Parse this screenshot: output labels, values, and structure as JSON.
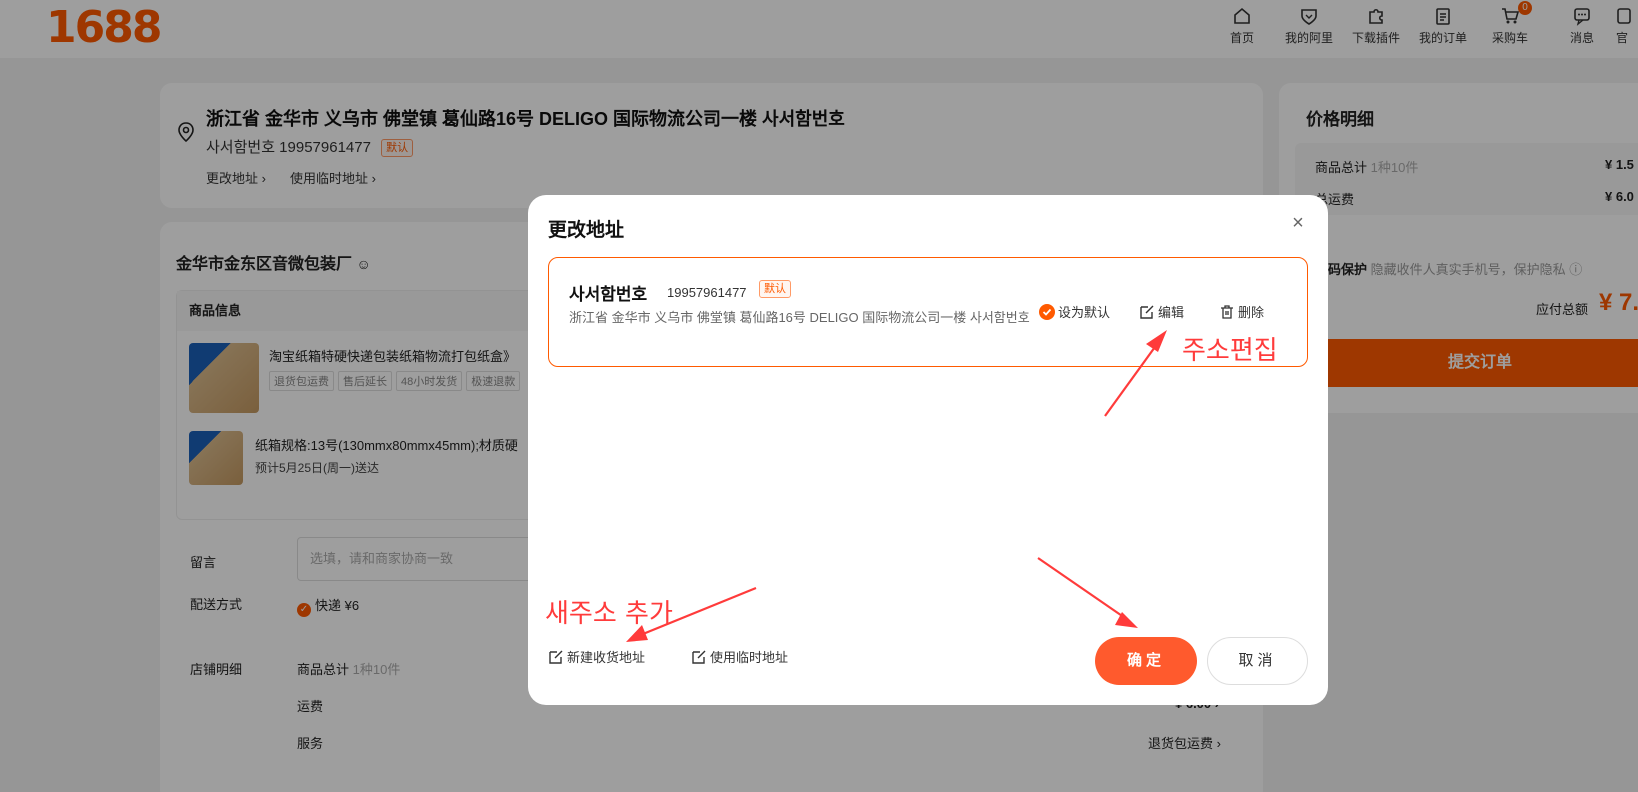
{
  "header": {
    "logo": "1688",
    "nav": [
      {
        "label": "首页",
        "icon": "home-icon"
      },
      {
        "label": "我的阿里",
        "icon": "heart-shield-icon"
      },
      {
        "label": "下载插件",
        "icon": "puzzle-icon"
      },
      {
        "label": "我的订单",
        "icon": "clipboard-icon"
      },
      {
        "label": "采购车",
        "icon": "cart-icon",
        "badge": "0"
      },
      {
        "label": "消息",
        "icon": "message-icon"
      },
      {
        "label": "官",
        "icon": "more-icon"
      }
    ]
  },
  "address_card": {
    "address_line": "浙江省 金华市 义乌市 佛堂镇 葛仙路16号 DELIGO 国际物流公司一楼 사서함번호",
    "name_phone": "사서함번호 19957961477",
    "default_tag": "默认",
    "change_link": "更改地址",
    "temp_link": "使用临时地址"
  },
  "shop": {
    "name": "金华市金东区音微包装厂",
    "goods_header": "商品信息",
    "item1": {
      "title": "淘宝纸箱特硬快递包装纸箱物流打包纸盒》",
      "tags": [
        "退货包运费",
        "售后延长",
        "48小时发货",
        "极速退款"
      ]
    },
    "item2": {
      "spec": "纸箱规格:13号(130mmx80mmx45mm);材质硬",
      "eta": "预计5月25日(周一)送达"
    },
    "message_label": "留言",
    "message_placeholder": "选填，请和商家协商一致",
    "shipping_label": "配送方式",
    "shipping_value": "快递 ¥6",
    "store_detail_label": "店铺明细",
    "goods_total_label": "商品总计",
    "goods_total_count": "1种10件",
    "freight_label": "运费",
    "freight_value": "¥ 6.00",
    "service_label": "服务",
    "service_value": "退货包运费"
  },
  "price_card": {
    "title": "价格明细",
    "goods_total_label": "商品总计",
    "goods_total_count": "1种10件",
    "goods_total_value": "¥ 1.5",
    "freight_label": "总运费",
    "freight_value": "¥ 6.0",
    "privacy_label": "号码保护",
    "privacy_desc": "隐藏收件人真实手机号，保护隐私",
    "payable_label": "应付总额",
    "payable_value": "¥ 7.",
    "submit": "提交订单"
  },
  "modal": {
    "title": "更改地址",
    "close": "×",
    "address": {
      "name": "사서함번호",
      "phone": "19957961477",
      "tag": "默认",
      "full": "浙江省 金华市 义乌市 佛堂镇 葛仙路16号 DELIGO 国际物流公司一楼 사서함번호",
      "set_default": "设为默认",
      "edit": "编辑",
      "delete": "删除"
    },
    "new_address": "新建收货地址",
    "temp_address": "使用临时地址",
    "confirm": "确定",
    "cancel": "取消"
  },
  "annotations": {
    "edit_note": "주소편집",
    "add_note": "새주소 추가",
    "color": "#ff3b3b"
  }
}
